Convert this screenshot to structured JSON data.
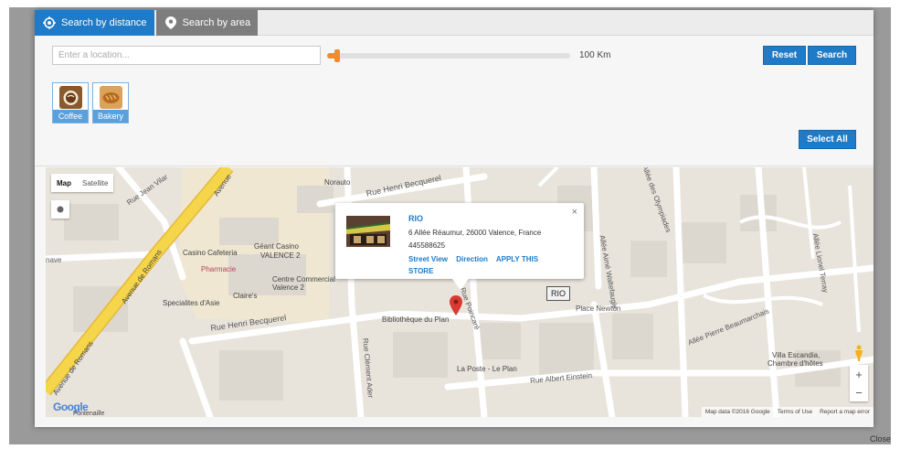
{
  "tabs": [
    {
      "label": "Search by distance",
      "icon": "crosshair-icon",
      "active": true
    },
    {
      "label": "Search by area",
      "icon": "location-pin-icon",
      "active": false
    }
  ],
  "search": {
    "placeholder": "Enter a location...",
    "value": "",
    "range_label": "100 Km",
    "slider_fraction": 0.04
  },
  "buttons": {
    "reset": "Reset",
    "search": "Search",
    "select_all": "Select All"
  },
  "categories": [
    {
      "label": "Coffee",
      "icon": "coffee-cup-icon"
    },
    {
      "label": "Bakery",
      "icon": "bread-icon"
    }
  ],
  "map": {
    "toggle": {
      "map": "Map",
      "satellite": "Satellite"
    },
    "labels": {
      "noranto": "Norauto",
      "rue_henri_becquerel_top": "Rue Henri Becquerel",
      "rue_henri_becquerel_bottom": "Rue Henri Becquerel",
      "rue_jean_vilar": "Rue Jean Vilar",
      "avenue_de_romans_1": "Avenue de Romans",
      "avenue_de_romans_2": "Avenue de Romans",
      "avenue_de_romans_3": "Avenue",
      "casino_cafeteria": "Casino Cafeteria",
      "geant_casino": "Géant Casino",
      "valence2_a": "VALENCE 2",
      "pharmacie": "Pharmacie",
      "centre_commercial": "Centre Commercial",
      "valence2_b": "Valence 2",
      "claires": "Claire's",
      "specialites": "Specialites d'Asie",
      "bibliotheque": "Bibliothèque du Plan",
      "la_poste": "La Poste - Le Plan",
      "rue_albert_einstein": "Rue Albert Einstein",
      "place_newton": "Place Newton",
      "allee_pierre": "Allée Pierre Beaumarchais",
      "villa_escandia": "Villa Escandia,",
      "chambre_hotes": "Chambre d'hôtes",
      "allee_lionel": "Allée Lionel Terray",
      "allee_des_olympiades": "Allée des Olympiades",
      "allee_amie": "Allée Aimé Waltefaugle",
      "rue_clement_ader": "Rue Clément Ader",
      "rue_poincare": "Rue Poincaré",
      "naive": "nave",
      "fontenaille": "Fontenaille"
    },
    "attribution": {
      "data": "Map data ©2016 Google",
      "terms": "Terms of Use",
      "report": "Report a map error"
    },
    "google_logo": "Google",
    "zoom_in": "+",
    "zoom_out": "−"
  },
  "infowindow": {
    "name": "RIO",
    "address": "6 Allée Réaumur, 26000 Valence, France",
    "phone": "445588625",
    "links": [
      "Street View",
      "Direction",
      "APPLY THIS STORE"
    ],
    "close": "×"
  },
  "marker_tag": "RIO",
  "footer": {
    "close": "Close"
  },
  "colors": {
    "accent": "#1f7bc7",
    "slider": "#f08c2a",
    "category_label": "#5aa0dc",
    "marker": "#d93a33",
    "highway": "#f5d64a"
  }
}
